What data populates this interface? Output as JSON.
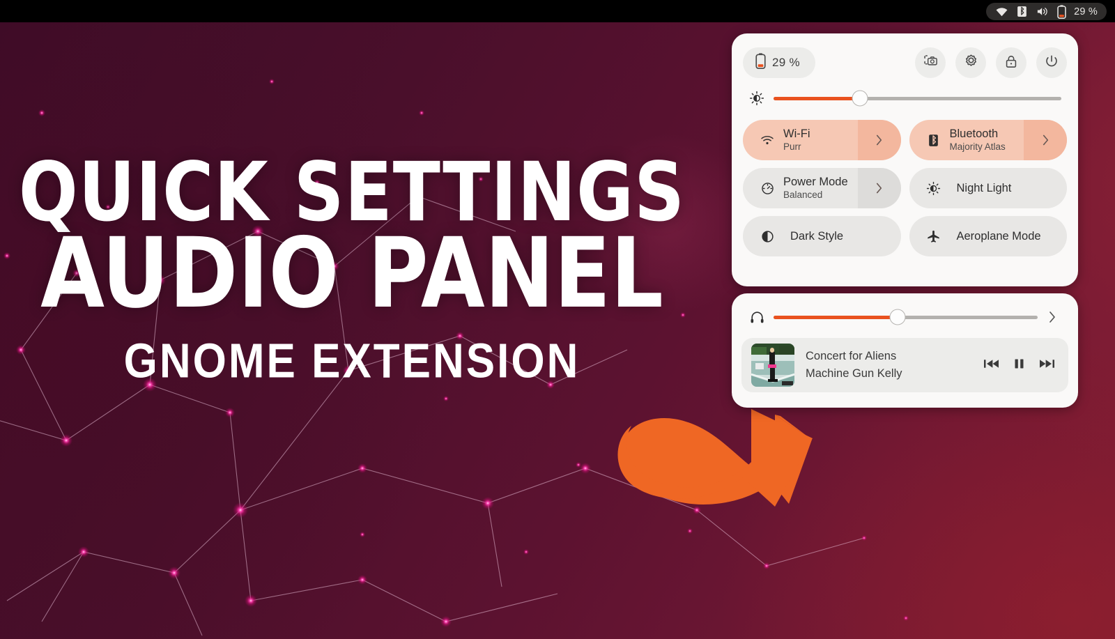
{
  "topbar": {
    "icons": [
      "wifi-icon",
      "bluetooth-icon",
      "volume-icon",
      "battery-icon"
    ],
    "battery_percent": "29 %"
  },
  "quick_settings": {
    "battery": {
      "label": "29 %",
      "icon": "battery-icon"
    },
    "actions": [
      {
        "name": "screenshot-button",
        "icon": "screenshot-icon"
      },
      {
        "name": "settings-button",
        "icon": "gear-icon"
      },
      {
        "name": "lock-button",
        "icon": "lock-icon"
      },
      {
        "name": "power-button",
        "icon": "power-icon"
      }
    ],
    "brightness": {
      "icon": "brightness-icon",
      "value": 30
    },
    "tiles": [
      {
        "name": "wifi-tile",
        "icon": "wifi-icon",
        "title": "Wi-Fi",
        "subtitle": "Purr",
        "active": true,
        "has_chevron": true
      },
      {
        "name": "bluetooth-tile",
        "icon": "bluetooth-icon",
        "title": "Bluetooth",
        "subtitle": "Majority Atlas",
        "active": true,
        "has_chevron": true
      },
      {
        "name": "power-mode-tile",
        "icon": "power-mode-icon",
        "title": "Power Mode",
        "subtitle": "Balanced",
        "active": false,
        "has_chevron": true
      },
      {
        "name": "night-light-tile",
        "icon": "night-light-icon",
        "title": "Night Light",
        "subtitle": "",
        "active": false,
        "has_chevron": false
      },
      {
        "name": "dark-style-tile",
        "icon": "dark-style-icon",
        "title": "Dark Style",
        "subtitle": "",
        "active": false,
        "has_chevron": false
      },
      {
        "name": "aeroplane-mode-tile",
        "icon": "aeroplane-icon",
        "title": "Aeroplane Mode",
        "subtitle": "",
        "active": false,
        "has_chevron": false
      }
    ]
  },
  "audio_panel": {
    "output": {
      "icon": "headphones-icon",
      "value": 47,
      "chevron": "chevron-right-icon"
    },
    "media_player": {
      "title": "Concert for Aliens",
      "artist": "Machine Gun Kelly",
      "album_art": "person-standing-in-empty-pool",
      "controls": [
        {
          "name": "previous-track-button",
          "icon": "previous-icon"
        },
        {
          "name": "play-pause-button",
          "icon": "pause-icon"
        },
        {
          "name": "next-track-button",
          "icon": "next-icon"
        }
      ]
    }
  },
  "hero": {
    "line1": "QUICK SETTINGS",
    "line2": "AUDIO PANEL",
    "line3": "GNOME EXTENSION"
  },
  "colors": {
    "accent_orange": "#e9521f",
    "arrow_orange": "#ef6724",
    "tile_active": "#f6c8b4",
    "tile_inactive": "#e8e7e5",
    "panel_bg": "#faf9f8",
    "wallpaper_dark": "#3d0c27",
    "wallpaper_light": "#7d1b33",
    "node_magenta": "#ff2ea6"
  }
}
